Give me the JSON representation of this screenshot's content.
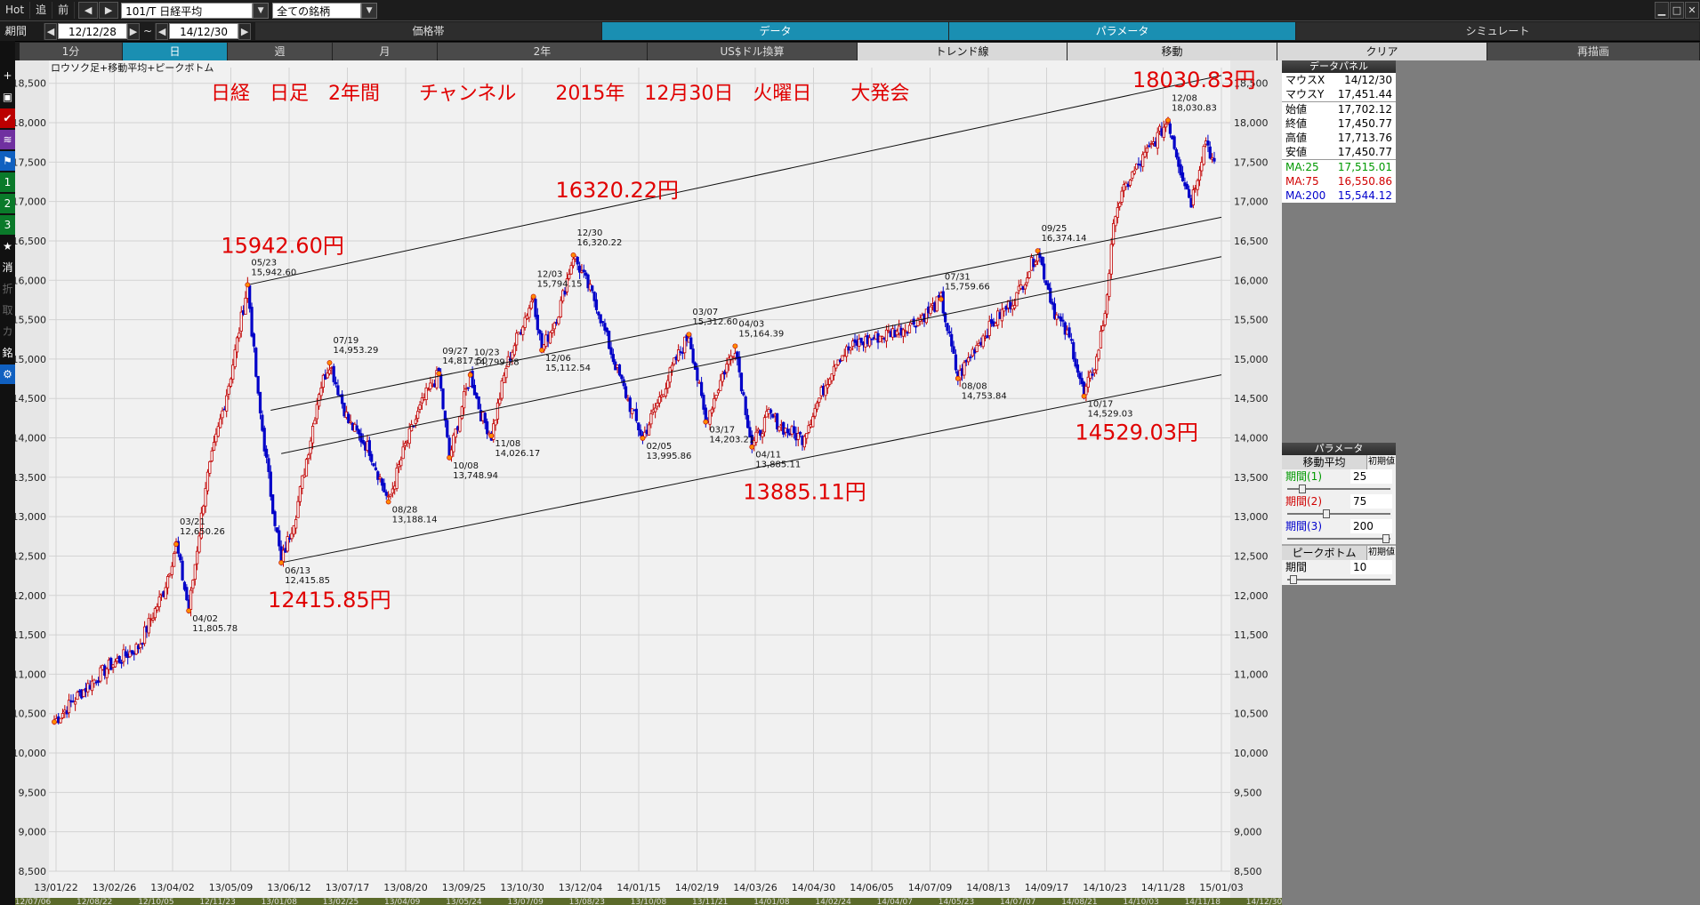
{
  "topbar": {
    "hot": "Hot",
    "fwd": "追",
    "prev": "前",
    "code": "101/T 日経平均",
    "filter": "全ての銘柄"
  },
  "periodbar": {
    "label": "期間",
    "from": "12/12/28",
    "tilde": "~",
    "to": "14/12/30",
    "menus": [
      "価格帯",
      "データ",
      "パラメータ",
      "シミュレート"
    ]
  },
  "timeframes": [
    "1分",
    "日",
    "週",
    "月",
    "2年",
    "US$ドル換算",
    "トレンド線",
    "移動",
    "クリア",
    "再描画"
  ],
  "leftbar": [
    "⌕",
    "+",
    "▣",
    "✔",
    "≋",
    "⚑",
    "1",
    "2",
    "3",
    "★",
    "消",
    "折",
    "取",
    "カ",
    "銘",
    "⚙"
  ],
  "chart_data": {
    "type": "candlestick",
    "title": "日経　日足　2年間　　チャンネル　　2015年　12月30日　火曜日　　大発会",
    "subtitle": "ロウソク足+移動平均+ピークボトム",
    "ylim": [
      8500,
      18700
    ],
    "yticks": [
      8500,
      9000,
      9500,
      10000,
      10500,
      11000,
      11500,
      12000,
      12500,
      13000,
      13500,
      14000,
      14500,
      15000,
      15500,
      16000,
      16500,
      17000,
      17500,
      18000,
      18500
    ],
    "xticks": [
      "13/01/22",
      "13/02/26",
      "13/04/02",
      "13/05/09",
      "13/06/12",
      "13/07/17",
      "13/08/20",
      "13/09/25",
      "13/10/30",
      "13/12/04",
      "14/01/15",
      "14/02/19",
      "14/03/26",
      "14/04/30",
      "14/06/05",
      "14/07/09",
      "14/08/13",
      "14/09/17",
      "14/10/23",
      "14/11/28",
      "15/01/03"
    ],
    "xticks2": [
      "12/07/06",
      "12/08/22",
      "12/10/05",
      "12/11/23",
      "13/01/08",
      "13/02/25",
      "13/04/09",
      "13/05/24",
      "13/07/09",
      "13/08/23",
      "13/10/08",
      "13/11/21",
      "14/01/08",
      "14/02/24",
      "14/04/07",
      "14/05/23",
      "14/07/07",
      "14/08/21",
      "14/10/03",
      "14/11/18",
      "14/12/30"
    ],
    "peaks": [
      {
        "date": "12/28",
        "value": 10395.18,
        "label": ""
      },
      {
        "date": "03/21",
        "value": 12650.26,
        "label": "03/21\n12,650.26"
      },
      {
        "date": "04/02",
        "value": 11805.78,
        "label": "04/02\n11,805.78"
      },
      {
        "date": "05/23",
        "value": 15942.6,
        "label": "05/23\n15,942.60"
      },
      {
        "date": "06/13",
        "value": 12415.85,
        "label": "06/13\n12,415.85"
      },
      {
        "date": "07/19",
        "value": 14953.29,
        "label": "07/19\n14,953.29"
      },
      {
        "date": "08/28",
        "value": 13188.14,
        "label": "08/28\n13,188.14"
      },
      {
        "date": "09/27",
        "value": 14817.5,
        "label": "09/27\n14,817.50"
      },
      {
        "date": "10/08",
        "value": 13748.94,
        "label": "10/08\n13,748.94"
      },
      {
        "date": "10/23",
        "value": 14799.28,
        "label": "10/23\n14,799.28"
      },
      {
        "date": "11/08",
        "value": 14026.17,
        "label": "11/08\n14,026.17"
      },
      {
        "date": "12/03",
        "value": 15794.15,
        "label": "12/03\n15,794.15"
      },
      {
        "date": "12/06",
        "value": 15112.54,
        "label": "12/06\n15,112.54"
      },
      {
        "date": "12/30",
        "value": 16320.22,
        "label": "12/30\n16,320.22"
      },
      {
        "date": "02/05",
        "value": 13995.86,
        "label": "02/05\n13,995.86"
      },
      {
        "date": "03/07",
        "value": 15312.6,
        "label": "03/07\n15,312.60"
      },
      {
        "date": "03/17",
        "value": 14203.21,
        "label": "03/17\n14,203.21"
      },
      {
        "date": "04/03",
        "value": 15164.39,
        "label": "04/03\n15,164.39"
      },
      {
        "date": "04/11",
        "value": 13885.11,
        "label": "04/11\n13,885.11"
      },
      {
        "date": "07/31",
        "value": 15759.66,
        "label": "07/31\n15,759.66"
      },
      {
        "date": "08/08",
        "value": 14753.84,
        "label": "08/08\n14,753.84"
      },
      {
        "date": "09/25",
        "value": 16374.14,
        "label": "09/25\n16,374.14"
      },
      {
        "date": "10/17",
        "value": 14529.03,
        "label": "10/17\n14,529.03"
      },
      {
        "date": "12/08",
        "value": 18030.83,
        "label": "12/08\n18,030.83"
      }
    ],
    "big_labels": [
      {
        "text": "15942.60円",
        "color": "#e00000"
      },
      {
        "text": "12415.85円",
        "color": "#e00000"
      },
      {
        "text": "16320.22円",
        "color": "#e00000"
      },
      {
        "text": "13885.11円",
        "color": "#e00000"
      },
      {
        "text": "14529.03円",
        "color": "#e00000"
      },
      {
        "text": "18030.83円",
        "color": "#e00000"
      }
    ],
    "series": [
      {
        "name": "MA:25",
        "color": "#00a000"
      },
      {
        "name": "MA:75",
        "color": "#e00000"
      },
      {
        "name": "MA:200",
        "color": "#0000e0"
      }
    ]
  },
  "datapanel": {
    "title": "データパネル",
    "rows": [
      {
        "k": "マウスX",
        "v": "14/12/30"
      },
      {
        "k": "マウスY",
        "v": "17,451.44"
      },
      {
        "k": "始値",
        "v": "17,702.12"
      },
      {
        "k": "終値",
        "v": "17,450.77"
      },
      {
        "k": "高値",
        "v": "17,713.76"
      },
      {
        "k": "安値",
        "v": "17,450.77"
      }
    ],
    "ma": [
      {
        "k": "MA:25",
        "v": "17,515.01",
        "color": "#009900"
      },
      {
        "k": "MA:75",
        "v": "16,550.86",
        "color": "#d00000"
      },
      {
        "k": "MA:200",
        "v": "15,544.12",
        "color": "#0000cc"
      }
    ]
  },
  "params": {
    "title": "パラメータ",
    "ma_title": "移動平均",
    "reset": "初期値",
    "items": [
      {
        "label": "期間(1)",
        "value": "25",
        "color": "#009900",
        "level": 0.12
      },
      {
        "label": "期間(2)",
        "value": "75",
        "color": "#d00000",
        "level": 0.37
      },
      {
        "label": "期間(3)",
        "value": "200",
        "color": "#0000cc",
        "level": 0.99
      }
    ],
    "pb_title": "ピークボトム",
    "pb_label": "期間",
    "pb_value": "10",
    "pb_level": 0.03
  }
}
